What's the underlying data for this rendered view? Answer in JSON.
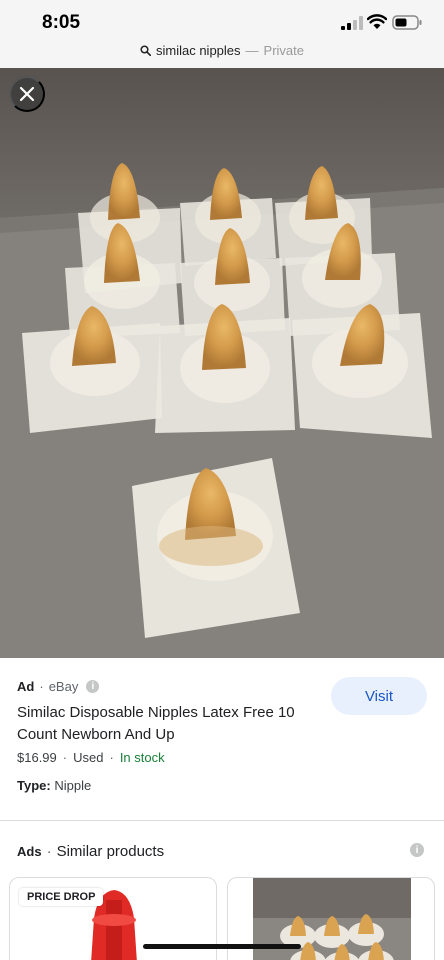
{
  "status_bar": {
    "time": "8:05",
    "icons": [
      "cellular-signal-icon",
      "wifi-icon",
      "battery-icon"
    ]
  },
  "url_bar": {
    "query": "similac nipples",
    "separator": "—",
    "mode": "Private",
    "icon": "search-icon"
  },
  "viewer": {
    "close_icon": "close-icon"
  },
  "ad": {
    "tag": "Ad",
    "separator": "·",
    "seller": "eBay",
    "info_icon": "i",
    "visit_label": "Visit",
    "title": "Similac Disposable Nipples Latex Free 10 Count Newborn And Up",
    "price": "$16.99",
    "condition": "Used",
    "availability": "In stock",
    "type_label": "Type:",
    "type_value": "Nipple"
  },
  "similar": {
    "ads_label": "Ads",
    "separator": "·",
    "title": "Similar products",
    "info_icon": "i",
    "cards": [
      {
        "badge": "PRICE DROP"
      },
      {
        "badge": ""
      }
    ]
  },
  "colors": {
    "accent": "#1a56c8",
    "visit_bg": "#e8f0fe",
    "in_stock": "#188038",
    "status_bg": "#f5f5f5"
  }
}
